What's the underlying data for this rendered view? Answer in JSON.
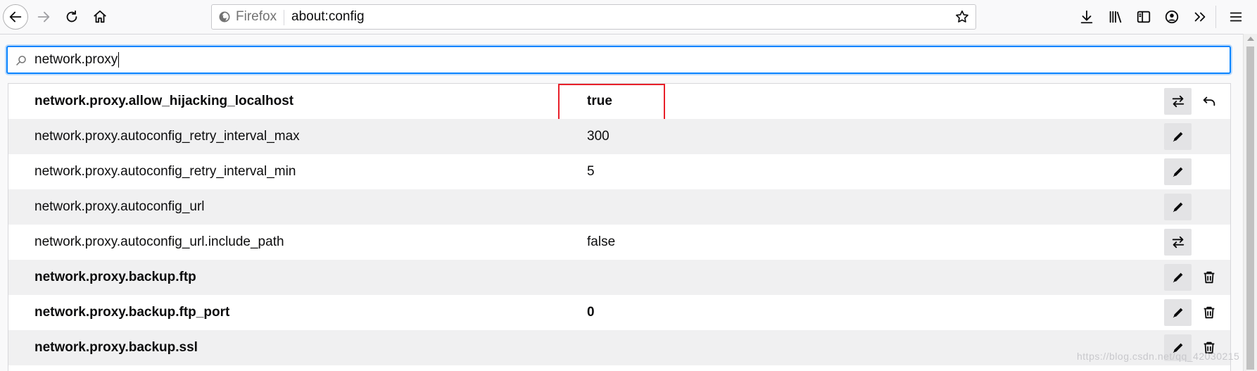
{
  "browser": {
    "identity_label": "Firefox",
    "url": "about:config"
  },
  "search": {
    "value": "network.proxy"
  },
  "prefs": [
    {
      "name": "network.proxy.allow_hijacking_localhost",
      "value": "true",
      "modified": true,
      "action": "toggle",
      "secondary": "reset"
    },
    {
      "name": "network.proxy.autoconfig_retry_interval_max",
      "value": "300",
      "modified": false,
      "action": "edit",
      "secondary": ""
    },
    {
      "name": "network.proxy.autoconfig_retry_interval_min",
      "value": "5",
      "modified": false,
      "action": "edit",
      "secondary": ""
    },
    {
      "name": "network.proxy.autoconfig_url",
      "value": "",
      "modified": false,
      "action": "edit",
      "secondary": ""
    },
    {
      "name": "network.proxy.autoconfig_url.include_path",
      "value": "false",
      "modified": false,
      "action": "toggle",
      "secondary": ""
    },
    {
      "name": "network.proxy.backup.ftp",
      "value": "",
      "modified": true,
      "action": "edit",
      "secondary": "delete"
    },
    {
      "name": "network.proxy.backup.ftp_port",
      "value": "0",
      "modified": true,
      "action": "edit",
      "secondary": "delete"
    },
    {
      "name": "network.proxy.backup.ssl",
      "value": "",
      "modified": true,
      "action": "edit",
      "secondary": "delete"
    }
  ],
  "icons": {
    "toggle": "toggle-arrows-icon",
    "edit": "pencil-icon",
    "reset": "undo-icon",
    "delete": "trash-icon"
  },
  "colors": {
    "highlight_box": "#e8202a",
    "focus_ring": "#0a84ff"
  },
  "watermark": "https://blog.csdn.net/qq_42030215"
}
